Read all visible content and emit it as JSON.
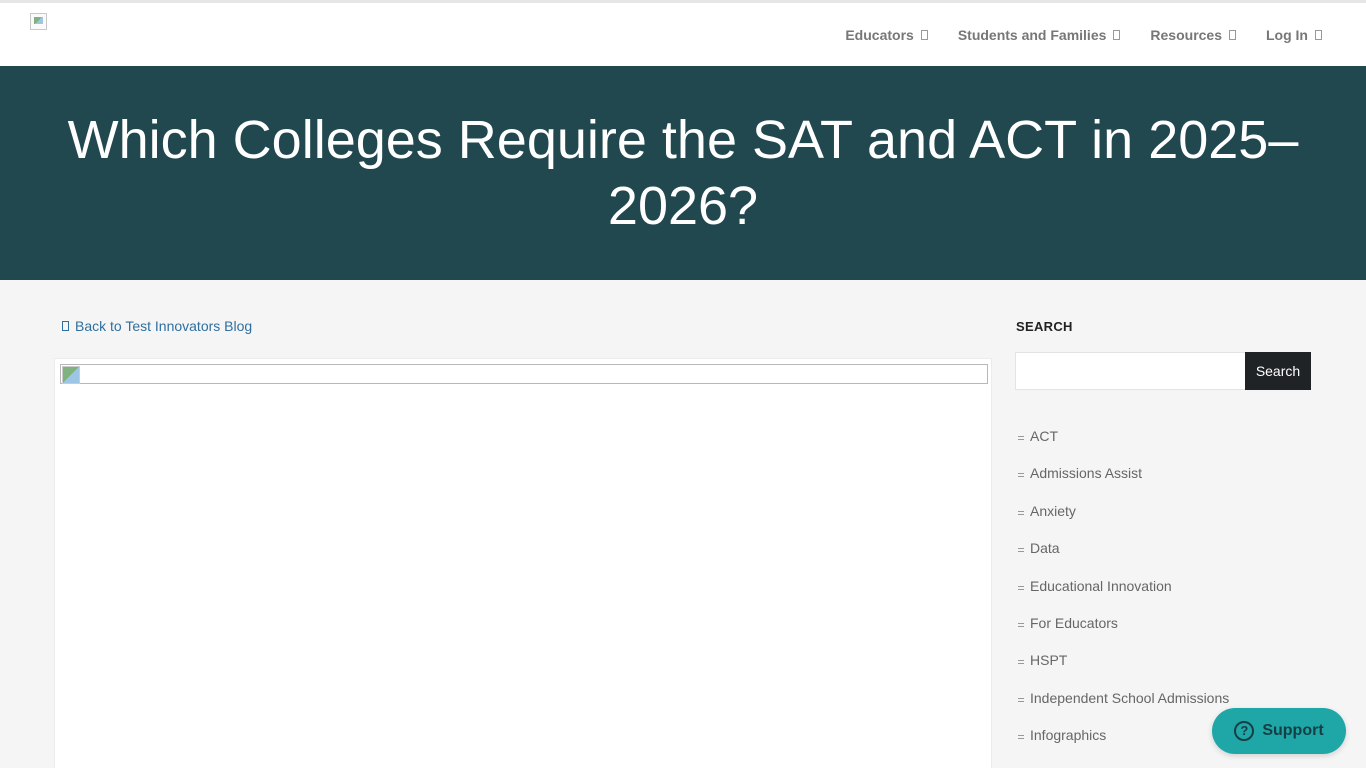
{
  "header": {
    "nav": [
      {
        "label": "Educators",
        "icon": "chevron-down-icon"
      },
      {
        "label": "Students and Families",
        "icon": "chevron-down-icon"
      },
      {
        "label": "Resources",
        "icon": "chevron-down-icon"
      },
      {
        "label": "Log In",
        "icon": "chevron-down-icon"
      }
    ]
  },
  "hero": {
    "title": "Which Colleges Require the SAT and ACT in 2025–2026?"
  },
  "article": {
    "back_link": "Back to Test Innovators Blog"
  },
  "sidebar": {
    "search_heading": "SEARCH",
    "search_placeholder": "",
    "search_button": "Search",
    "categories": [
      "ACT",
      "Admissions Assist",
      "Anxiety",
      "Data",
      "Educational Innovation",
      "For Educators",
      "HSPT",
      "Independent School Admissions",
      "Infographics"
    ]
  },
  "support": {
    "label": "Support",
    "icon": "question-icon"
  },
  "colors": {
    "hero_bg": "#21484f",
    "link": "#2f6f9f",
    "support_bg": "#1fa7a7",
    "search_button_bg": "#202326"
  }
}
